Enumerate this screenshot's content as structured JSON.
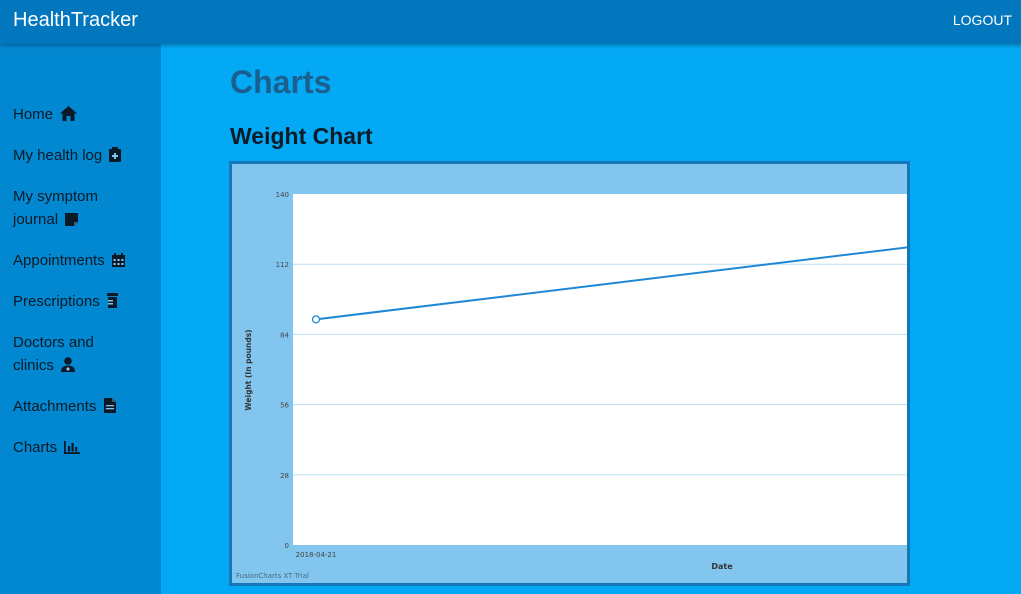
{
  "app": {
    "title": "HealthTracker",
    "logout_label": "LOGOUT"
  },
  "sidebar": {
    "items": [
      {
        "label": "Home",
        "icon": "home-icon"
      },
      {
        "label": "My health log",
        "icon": "clipboard-plus-icon"
      },
      {
        "label": "My symptom journal",
        "icon": "sticky-note-icon"
      },
      {
        "label": "Appointments",
        "icon": "calendar-icon"
      },
      {
        "label": "Prescriptions",
        "icon": "prescription-bottle-icon"
      },
      {
        "label": "Doctors and clinics",
        "icon": "user-doctor-icon"
      },
      {
        "label": "Attachments",
        "icon": "file-icon"
      },
      {
        "label": "Charts",
        "icon": "bar-chart-icon"
      }
    ]
  },
  "main": {
    "title": "Charts",
    "section_title": "Weight Chart"
  },
  "colors": {
    "topbar": "#0277bd",
    "sidebar": "#0288d1",
    "content": "#03a9f4",
    "chart_frame": "#82c6ef",
    "series_line": "#1e88d6"
  },
  "chart_data": {
    "type": "line",
    "title": "Weight Chart",
    "xlabel": "Date",
    "ylabel": "Weight (In pounds)",
    "ylim": [
      0,
      140
    ],
    "yticks": [
      0,
      28,
      56,
      84,
      112,
      140
    ],
    "x_tick_labels": [
      "2018-04-21"
    ],
    "points": [
      {
        "x": "2018-04-21",
        "y": 90
      },
      {
        "x": "",
        "y": 119
      }
    ],
    "grid": true,
    "watermark": "FusionCharts XT Trial"
  }
}
